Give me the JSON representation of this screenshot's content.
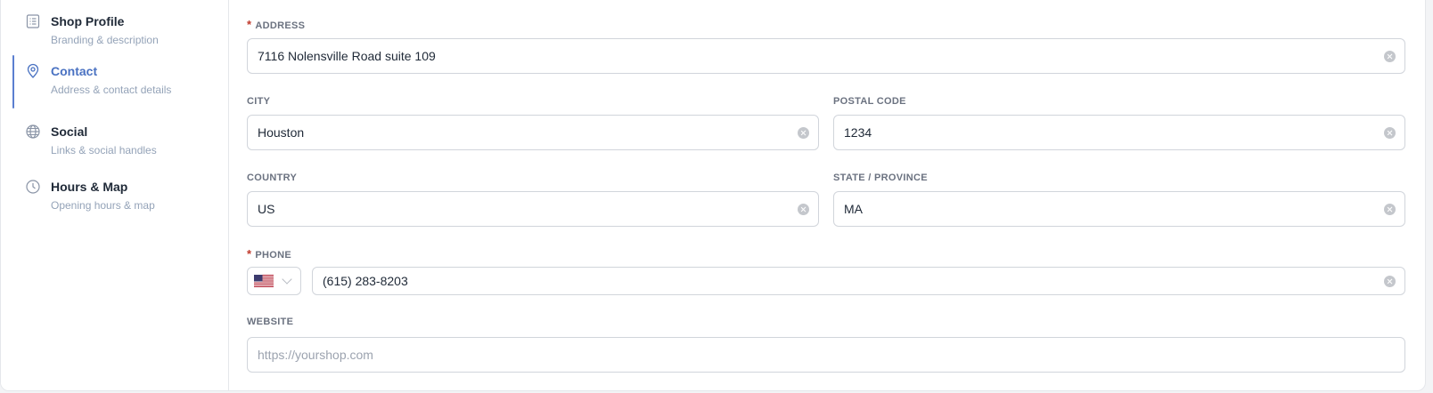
{
  "sidebar": {
    "items": [
      {
        "label": "Shop Profile",
        "desc": "Branding & description",
        "icon": "document-list-icon"
      },
      {
        "label": "Contact",
        "desc": "Address & contact details",
        "icon": "map-pin-icon"
      },
      {
        "label": "Social",
        "desc": "Links & social handles",
        "icon": "globe-icon"
      },
      {
        "label": "Hours & Map",
        "desc": "Opening hours & map",
        "icon": "clock-icon"
      }
    ]
  },
  "form": {
    "address": {
      "label": "ADDRESS",
      "value": "7116 Nolensville Road suite 109",
      "required": true
    },
    "city": {
      "label": "CITY",
      "value": "Houston"
    },
    "postal": {
      "label": "POSTAL CODE",
      "value": "1234"
    },
    "country": {
      "label": "COUNTRY",
      "value": "US"
    },
    "state": {
      "label": "STATE / PROVINCE",
      "value": "MA"
    },
    "phone": {
      "label": "PHONE",
      "value": "(615) 283-8203",
      "required": true,
      "country_flag": "us-flag-icon"
    },
    "website": {
      "label": "WEBSITE",
      "value": "",
      "placeholder": "https://yourshop.com"
    },
    "required_marker": "*"
  },
  "colors": {
    "accent": "#4a72c2",
    "required": "#c0392b",
    "muted": "#94a3b8"
  }
}
